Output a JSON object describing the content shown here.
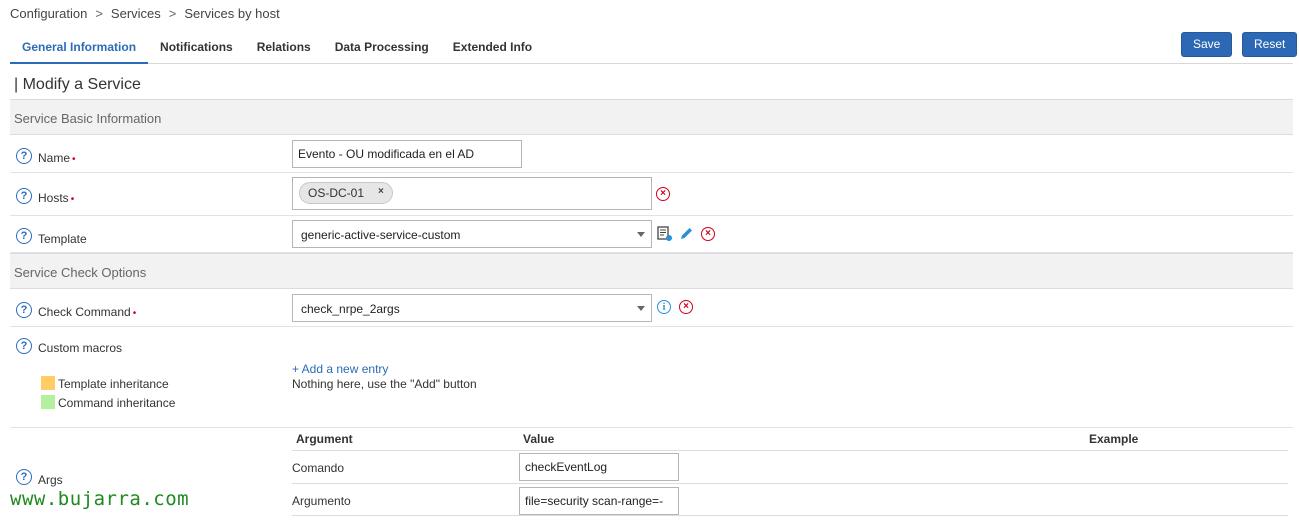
{
  "breadcrumb": [
    "Configuration",
    "Services",
    "Services by host"
  ],
  "breadcrumb_sep": ">",
  "tabs": [
    "General Information",
    "Notifications",
    "Relations",
    "Data Processing",
    "Extended Info"
  ],
  "buttons": {
    "save": "Save",
    "reset": "Reset"
  },
  "page_title": "| Modify a Service",
  "sections": {
    "basic": "Service Basic Information",
    "check": "Service Check Options"
  },
  "fields": {
    "name": {
      "label": "Name",
      "value": "Evento - OU modificada en el AD"
    },
    "hosts": {
      "label": "Hosts",
      "chip": "OS-DC-01",
      "chip_remove": "×"
    },
    "template": {
      "label": "Template",
      "value": "generic-active-service-custom"
    },
    "check_command": {
      "label": "Check Command",
      "value": "check_nrpe_2args"
    },
    "custom_macros": {
      "label": "Custom macros",
      "add_link": "+ Add a new entry",
      "empty_text": "Nothing here, use the \"Add\" button",
      "legend_template": "Template inheritance",
      "legend_command": "Command inheritance"
    },
    "args": {
      "label": "Args",
      "columns": [
        "Argument",
        "Value",
        "Example"
      ],
      "rows": [
        {
          "argument": "Comando",
          "value": "checkEventLog"
        },
        {
          "argument": "Argumento",
          "value": "file=security scan-range=-"
        }
      ]
    }
  },
  "required_mark": "•",
  "help_glyph": "?",
  "icons": {
    "help": "question-circle-icon",
    "remove": "circle-x-icon",
    "info": "info-circle-icon",
    "edit": "pencil-icon",
    "view": "document-view-icon"
  },
  "colors": {
    "accent": "#2b6cb8",
    "button": "#2d68b4",
    "danger": "#d0021b",
    "legend_template": "#ffcc66",
    "legend_command": "#b3f0a0",
    "watermark": "#1f8a1f"
  },
  "watermark": "www.bujarra.com"
}
